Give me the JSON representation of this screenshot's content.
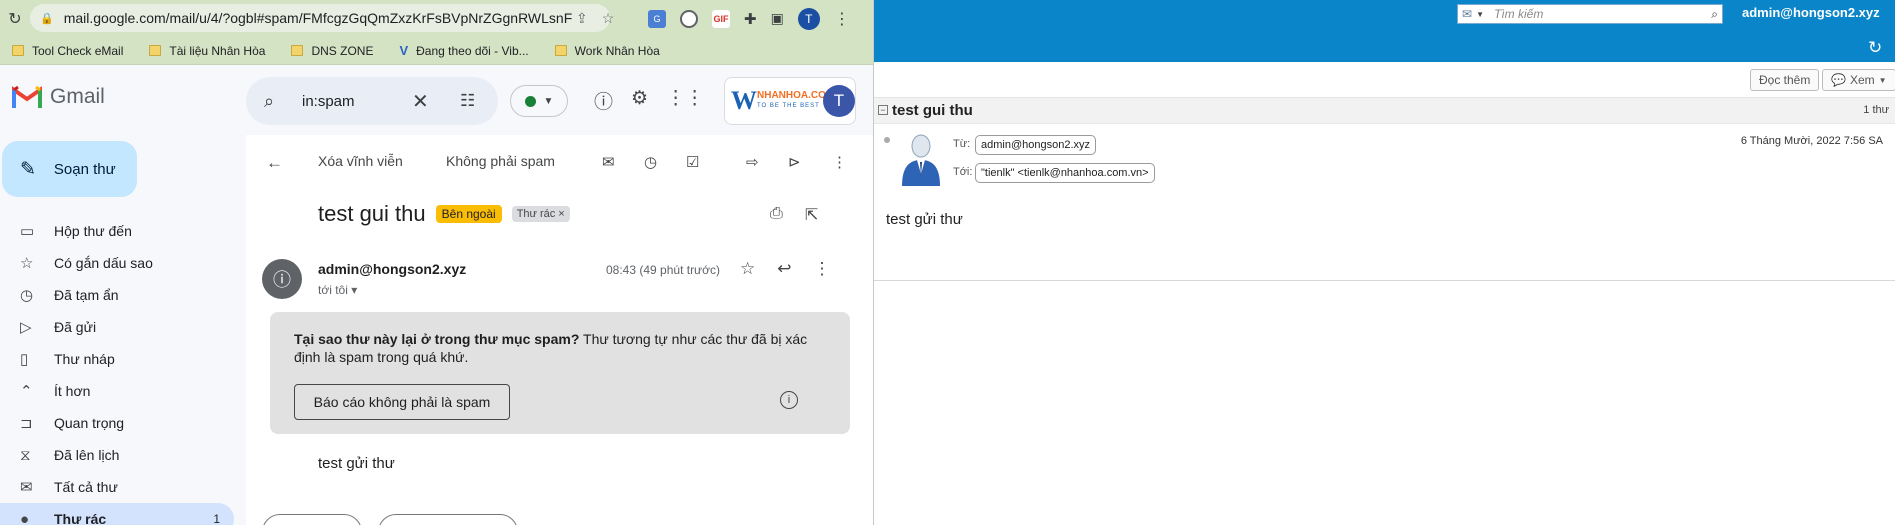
{
  "browser": {
    "url": "mail.google.com/mail/u/4/?ogbl#spam/FMfcgzGqQmZxzKrFsBVpNrZGgnRWLsnF",
    "profile_initial": "T",
    "ext_label": "GIF",
    "bookmarks": [
      {
        "label": "Tool Check eMail"
      },
      {
        "label": "Tài liệu Nhân Hòa"
      },
      {
        "label": "DNS ZONE"
      },
      {
        "label": "Đang theo dõi - Vib..."
      },
      {
        "label": "Work Nhân Hòa"
      }
    ]
  },
  "gmail": {
    "logo_text": "Gmail",
    "search_value": "in:spam",
    "account_initial": "T",
    "account_logo": "NHANHOA.COM",
    "account_logo_sub": "TO BE THE BEST",
    "compose_label": "Soạn thư",
    "nav": [
      {
        "label": "Hộp thư đến",
        "icon": "inbox-icon"
      },
      {
        "label": "Có gắn dấu sao",
        "icon": "star-icon"
      },
      {
        "label": "Đã tạm ẩn",
        "icon": "clock-icon"
      },
      {
        "label": "Đã gửi",
        "icon": "send-icon"
      },
      {
        "label": "Thư nháp",
        "icon": "draft-icon"
      },
      {
        "label": "Ít hơn",
        "icon": "chevron-up-icon"
      },
      {
        "label": "Quan trọng",
        "icon": "important-icon"
      },
      {
        "label": "Đã lên lịch",
        "icon": "scheduled-icon"
      },
      {
        "label": "Tất cả thư",
        "icon": "all-mail-icon"
      },
      {
        "label": "Thư rác",
        "icon": "spam-icon",
        "count": "1",
        "active": true
      }
    ],
    "toolbar": {
      "delete_forever": "Xóa vĩnh viễn",
      "not_spam": "Không phải spam"
    },
    "message": {
      "subject": "test gui thu",
      "badge_external": "Bên ngoài",
      "badge_spam": "Thư rác",
      "from": "admin@hongson2.xyz",
      "to": "tới tôi",
      "time": "08:43 (49 phút trước)",
      "spam_reason_bold": "Tại sao thư này lại ở trong thư mục spam?",
      "spam_reason_rest": " Thư tương tự như các thư đã bị xác định là spam trong quá khứ.",
      "report_not_spam": "Báo cáo không phải là spam",
      "body": "test gửi thư"
    },
    "colors": {
      "compose_bg": "#c2e7ff",
      "active_nav": "#d3e3fd",
      "badge_external": "#fbbc04"
    }
  },
  "webmail": {
    "search_placeholder": "Tìm kiếm",
    "user": "admin@hongson2.xyz",
    "read_more": "Đọc thêm",
    "view": "Xem",
    "subject": "test gui thu",
    "count": "1 thư",
    "from_label": "Từ:",
    "from": "admin@hongson2.xyz",
    "to_label": "Tới:",
    "to": "\"tienlk\" <tienlk@nhanhoa.com.vn>",
    "date": "6 Tháng Mười, 2022 7:56 SA",
    "body": "test gửi thư",
    "colors": {
      "topbar": "#0a85c9"
    }
  }
}
